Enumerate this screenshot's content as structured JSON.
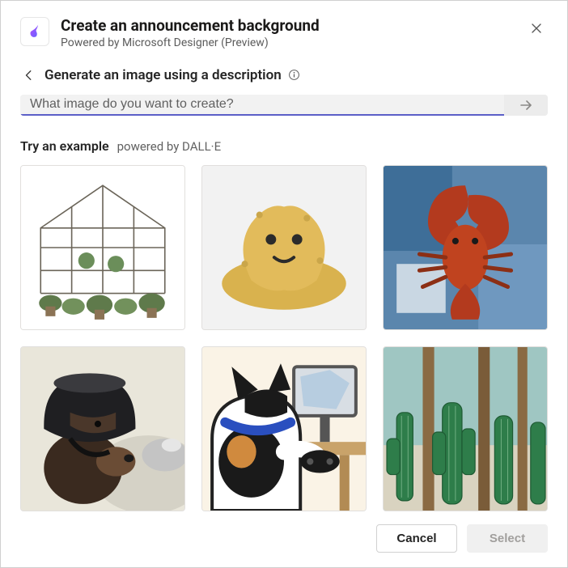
{
  "header": {
    "title": "Create an announcement background",
    "subtitle": "Powered by Microsoft Designer (Preview)"
  },
  "backrow": {
    "label": "Generate an image using a description"
  },
  "prompt": {
    "placeholder": "What image do you want to create?",
    "value": ""
  },
  "examples": {
    "heading": "Try an example",
    "powered_by": "powered by DALL·E",
    "items": [
      {
        "name": "example-greenhouse"
      },
      {
        "name": "example-sponge-plush"
      },
      {
        "name": "example-lobster-painting"
      },
      {
        "name": "example-bear-helmet"
      },
      {
        "name": "example-cat-gaming"
      },
      {
        "name": "example-cactus-collage"
      }
    ]
  },
  "footer": {
    "cancel": "Cancel",
    "select": "Select"
  }
}
